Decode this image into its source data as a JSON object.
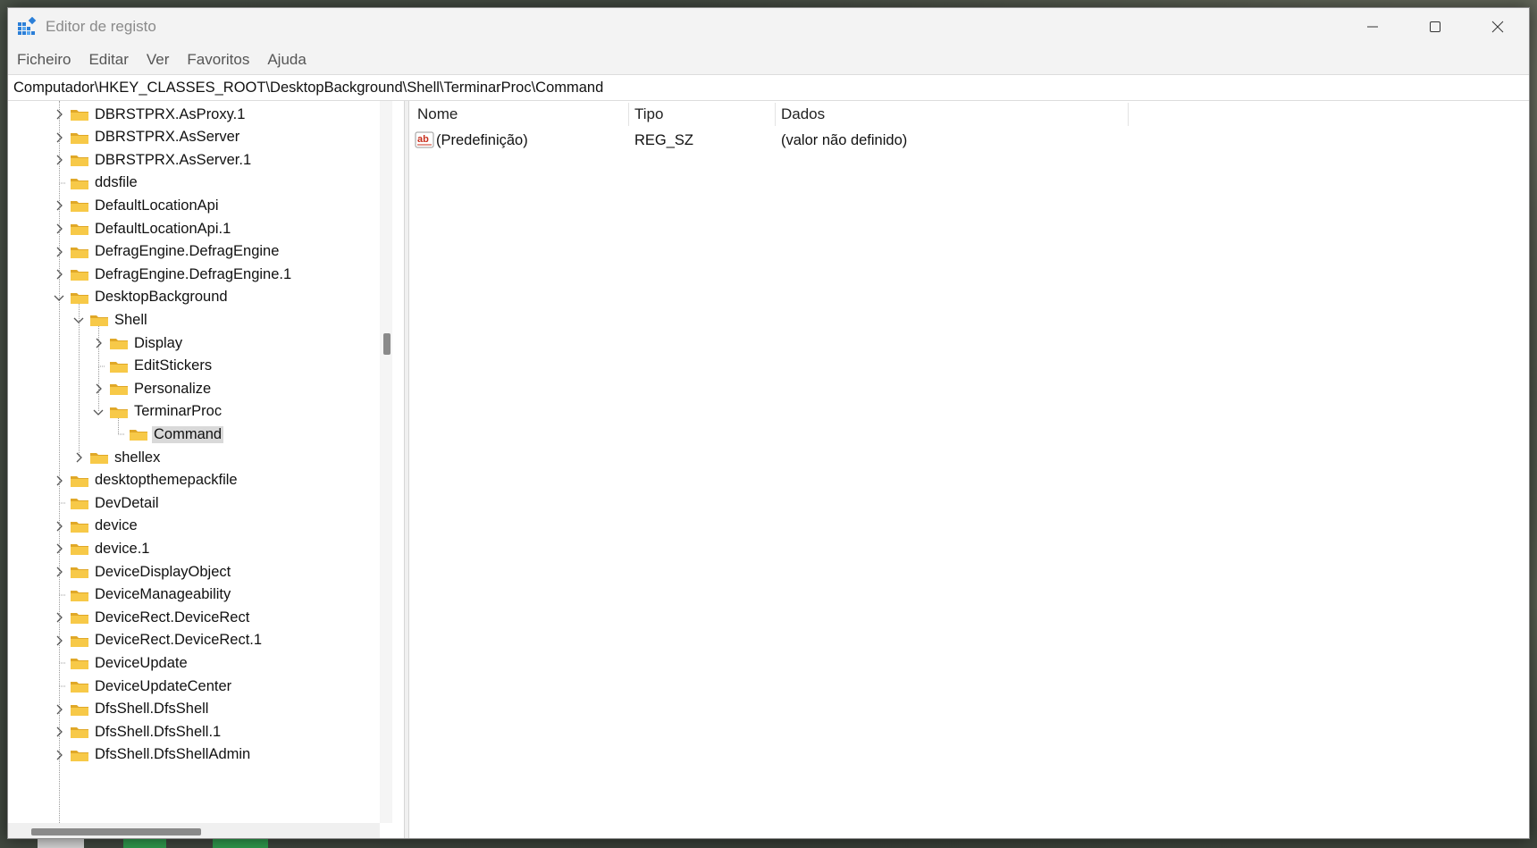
{
  "window": {
    "title": "Editor de registo"
  },
  "menu": [
    "Ficheiro",
    "Editar",
    "Ver",
    "Favoritos",
    "Ajuda"
  ],
  "address": "Computador\\HKEY_CLASSES_ROOT\\DesktopBackground\\Shell\\TerminarProc\\Command",
  "tree": [
    {
      "label": "DBRSTPRX.AsProxy.1",
      "level": 0,
      "state": "collapsed"
    },
    {
      "label": "DBRSTPRX.AsServer",
      "level": 0,
      "state": "collapsed"
    },
    {
      "label": "DBRSTPRX.AsServer.1",
      "level": 0,
      "state": "collapsed"
    },
    {
      "label": "ddsfile",
      "level": 0,
      "state": "leaf"
    },
    {
      "label": "DefaultLocationApi",
      "level": 0,
      "state": "collapsed"
    },
    {
      "label": "DefaultLocationApi.1",
      "level": 0,
      "state": "collapsed"
    },
    {
      "label": "DefragEngine.DefragEngine",
      "level": 0,
      "state": "collapsed"
    },
    {
      "label": "DefragEngine.DefragEngine.1",
      "level": 0,
      "state": "collapsed"
    },
    {
      "label": "DesktopBackground",
      "level": 0,
      "state": "expanded"
    },
    {
      "label": "Shell",
      "level": 1,
      "state": "expanded"
    },
    {
      "label": "Display",
      "level": 2,
      "state": "collapsed"
    },
    {
      "label": "EditStickers",
      "level": 2,
      "state": "leaf"
    },
    {
      "label": "Personalize",
      "level": 2,
      "state": "collapsed"
    },
    {
      "label": "TerminarProc",
      "level": 2,
      "state": "expanded"
    },
    {
      "label": "Command",
      "level": 3,
      "state": "leaf",
      "selected": true
    },
    {
      "label": "shellex",
      "level": 1,
      "state": "collapsed"
    },
    {
      "label": "desktopthemepackfile",
      "level": 0,
      "state": "collapsed"
    },
    {
      "label": "DevDetail",
      "level": 0,
      "state": "leaf"
    },
    {
      "label": "device",
      "level": 0,
      "state": "collapsed"
    },
    {
      "label": "device.1",
      "level": 0,
      "state": "collapsed"
    },
    {
      "label": "DeviceDisplayObject",
      "level": 0,
      "state": "collapsed"
    },
    {
      "label": "DeviceManageability",
      "level": 0,
      "state": "leaf"
    },
    {
      "label": "DeviceRect.DeviceRect",
      "level": 0,
      "state": "collapsed"
    },
    {
      "label": "DeviceRect.DeviceRect.1",
      "level": 0,
      "state": "collapsed"
    },
    {
      "label": "DeviceUpdate",
      "level": 0,
      "state": "leaf"
    },
    {
      "label": "DeviceUpdateCenter",
      "level": 0,
      "state": "leaf"
    },
    {
      "label": "DfsShell.DfsShell",
      "level": 0,
      "state": "collapsed"
    },
    {
      "label": "DfsShell.DfsShell.1",
      "level": 0,
      "state": "collapsed"
    },
    {
      "label": "DfsShell.DfsShellAdmin",
      "level": 0,
      "state": "collapsed"
    }
  ],
  "list": {
    "columns": [
      "Nome",
      "Tipo",
      "Dados"
    ],
    "rows": [
      {
        "name": "(Predefinição)",
        "type": "REG_SZ",
        "data": "(valor não definido)",
        "icon": "string-value-icon"
      }
    ]
  },
  "colors": {
    "folder": "#f7c948",
    "folder_dark": "#e0a828",
    "selection": "#d9d9d9",
    "icon_red": "#c8301e"
  }
}
